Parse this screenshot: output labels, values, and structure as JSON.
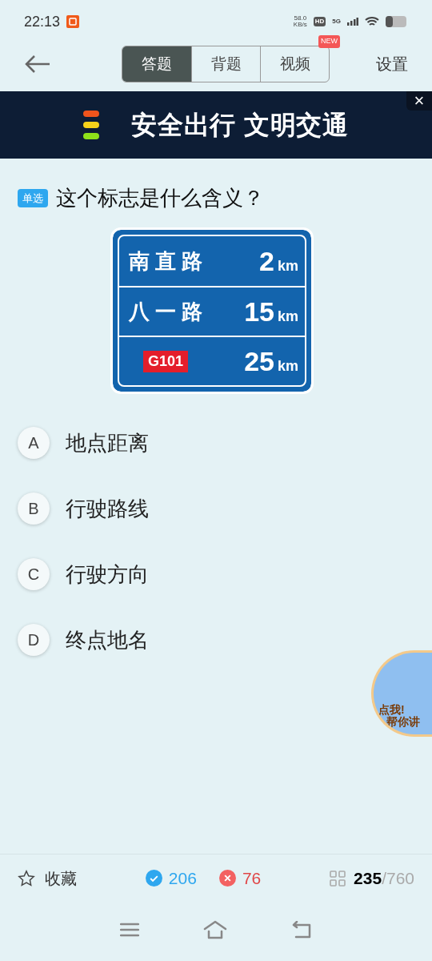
{
  "status_bar": {
    "time": "22:13",
    "speed_value": "58.0",
    "speed_unit": "KB/s",
    "network": "5G",
    "hd": "HD"
  },
  "header": {
    "tabs": [
      {
        "label": "答题",
        "selected": true
      },
      {
        "label": "背题",
        "selected": false
      },
      {
        "label": "视频",
        "selected": false,
        "badge": "NEW"
      }
    ],
    "settings": "设置"
  },
  "banner": {
    "text": "安全出行 文明交通",
    "close": "×"
  },
  "question": {
    "type_tag": "单选",
    "text": "这个标志是什么含义？",
    "sign": {
      "rows": [
        {
          "kind": "name",
          "place": "南 直 路",
          "distance": "2",
          "unit": "km"
        },
        {
          "kind": "name",
          "place": "八 一 路",
          "distance": "15",
          "unit": "km"
        },
        {
          "kind": "route",
          "place": "G101",
          "distance": "25",
          "unit": "km"
        }
      ]
    }
  },
  "options": [
    {
      "letter": "A",
      "text": "地点距离",
      "selected": false
    },
    {
      "letter": "B",
      "text": "行驶路线",
      "selected": false
    },
    {
      "letter": "C",
      "text": "行驶方向",
      "selected": false
    },
    {
      "letter": "D",
      "text": "终点地名",
      "selected": false
    }
  ],
  "helper": {
    "line1": "点我!",
    "line2": "帮你讲"
  },
  "footer": {
    "favorite": "收藏",
    "correct": "206",
    "wrong": "76",
    "current": "235",
    "total": "/760"
  }
}
